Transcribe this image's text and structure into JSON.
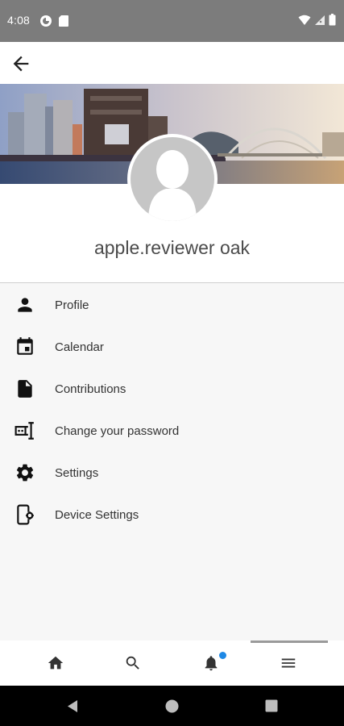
{
  "status_bar": {
    "time": "4:08"
  },
  "colors": {
    "status_bar": "#7c7c7c",
    "icon_color": "#111111",
    "notification_badge": "#1e88e5",
    "avatar_placeholder": "#c6c6c6"
  },
  "profile": {
    "username": "apple.reviewer oak"
  },
  "menu": {
    "items": [
      {
        "label": "Profile",
        "icon": "person-icon"
      },
      {
        "label": "Calendar",
        "icon": "calendar-icon"
      },
      {
        "label": "Contributions",
        "icon": "document-icon"
      },
      {
        "label": "Change your password",
        "icon": "password-icon"
      },
      {
        "label": "Settings",
        "icon": "gear-icon"
      },
      {
        "label": "Device Settings",
        "icon": "device-settings-icon"
      }
    ]
  },
  "bottom_nav": {
    "items": [
      "home-icon",
      "search-icon",
      "bell-icon",
      "menu-icon"
    ],
    "active": "menu-icon"
  }
}
